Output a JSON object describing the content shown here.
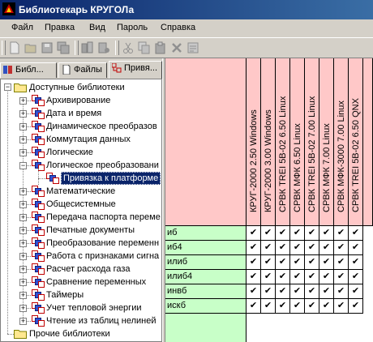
{
  "window": {
    "title": "Библиотекарь КРУГОЛа"
  },
  "menu": [
    "Файл",
    "Правка",
    "Вид",
    "Пароль",
    "Справка"
  ],
  "tabs": [
    {
      "label": "Библ..."
    },
    {
      "label": "Файлы"
    },
    {
      "label": "Привя..."
    }
  ],
  "tree": {
    "root": "Доступные библиотеки",
    "items": [
      {
        "label": "Архивирование"
      },
      {
        "label": "Дата и время"
      },
      {
        "label": "Динамическое преобразов"
      },
      {
        "label": "Коммутация данных"
      },
      {
        "label": "Логические"
      },
      {
        "label": "Логическое преобразовани"
      },
      {
        "label": "Привязка к платформе"
      },
      {
        "label": "Математические"
      },
      {
        "label": "Общесистемные"
      },
      {
        "label": "Передача паспорта переме"
      },
      {
        "label": "Печатные документы"
      },
      {
        "label": "Преобразование переменн"
      },
      {
        "label": "Работа с признаками сигна"
      },
      {
        "label": "Расчет расхода газа"
      },
      {
        "label": "Сравнение переменных"
      },
      {
        "label": "Таймеры"
      },
      {
        "label": "Учет тепловой энергии"
      },
      {
        "label": "Чтение из таблиц нелиней"
      }
    ],
    "other": "Прочие библиотеки"
  },
  "grid": {
    "columns": [
      "КРУГ-2000 2.50 Windows",
      "КРУГ-2000 3.00 Windows",
      "СРВК TREI 5B-02 6.50 Linux",
      "СРВК МФК 6.50 Linux",
      "СРВК TREI 5B-02 7.00 Linux",
      "СРВК МФК 7.00 Linux",
      "СРВК МФК-3000 7.00 Linux",
      "СРВК TREI 5B-02 6.50 QNX"
    ],
    "rows": [
      "иб",
      "иб4",
      "илиб",
      "илиб4",
      "инвб",
      "искб"
    ],
    "check": "✔"
  }
}
